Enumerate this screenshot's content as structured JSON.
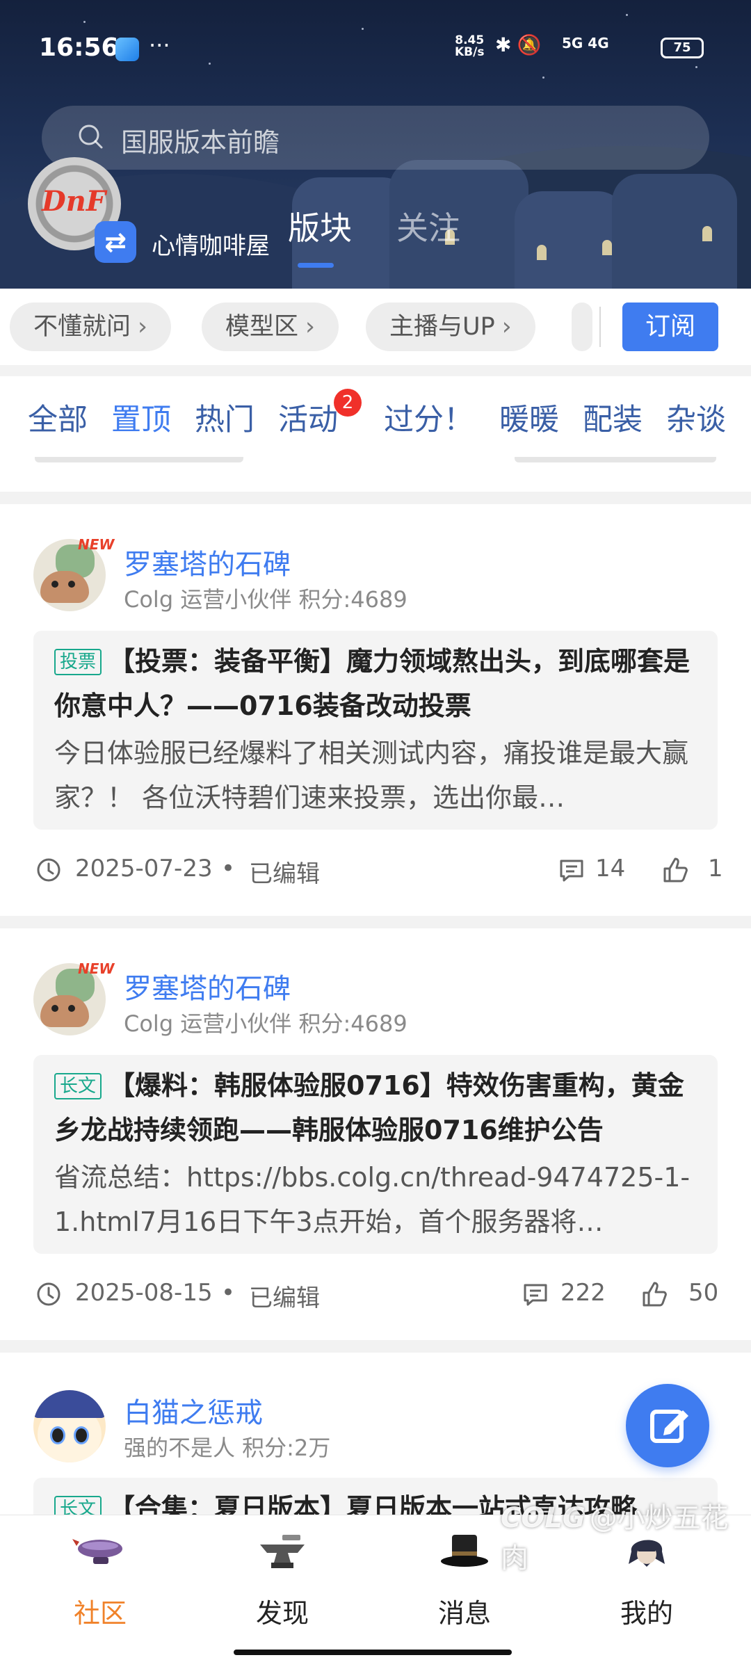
{
  "status_bar": {
    "time": "16:56",
    "dots": "···",
    "net_speed_top": "8.45",
    "net_speed_bottom": "KB/s",
    "signal_labels": "5G 4G",
    "battery": "75"
  },
  "search": {
    "placeholder": "国服版本前瞻"
  },
  "header": {
    "logo_text": "DnF",
    "board_name": "心情咖啡屋",
    "tabs": [
      {
        "label": "版块"
      },
      {
        "label": "关注"
      }
    ]
  },
  "filter_chips": [
    {
      "label": "不懂就问"
    },
    {
      "label": "模型区"
    },
    {
      "label": "主播与UP"
    }
  ],
  "subscribe_label": "订阅",
  "categories": [
    {
      "label": "全部"
    },
    {
      "label": "置顶"
    },
    {
      "label": "热门"
    },
    {
      "label": "活动"
    },
    {
      "label": "过分！"
    },
    {
      "label": "暖暖"
    },
    {
      "label": "配装"
    },
    {
      "label": "杂谈"
    }
  ],
  "category_badge": "2",
  "posts": [
    {
      "new_tag": "NEW",
      "author": "罗塞塔的石碑",
      "author_meta": "Colg 运营小伙伴  积分:4689",
      "tag": "投票",
      "title": "【投票：装备平衡】魔力领域熬出头，到底哪套是你意中人？——0716装备改动投票",
      "excerpt": " 今日体验服已经爆料了相关测试内容，痛投谁是最大赢家？！ 各位沃特碧们速来投票，选出你最…",
      "date": "2025-07-23",
      "dot": "•",
      "edited": "已编辑",
      "comments": "14",
      "likes": "1"
    },
    {
      "new_tag": "NEW",
      "author": "罗塞塔的石碑",
      "author_meta": "Colg 运营小伙伴  积分:4689",
      "tag": "长文",
      "title": "【爆料：韩服体验服0716】特效伤害重构，黄金乡龙战持续领跑——韩服体验服0716维护公告",
      "excerpt": " 省流总结：https://bbs.colg.cn/thread-9474725-1-1.html7月16日下午3点开始，首个服务器将…",
      "date": "2025-08-15",
      "dot": "•",
      "edited": "已编辑",
      "comments": "222",
      "likes": "50"
    },
    {
      "author": "白猫之惩戒",
      "author_meta": "强的不是人  积分:2万",
      "tag": "长文",
      "title": "【合集：夏日版本】夏日版本一站式直达攻略"
    }
  ],
  "bottom_nav": [
    {
      "label": "社区",
      "icon": "airship-icon"
    },
    {
      "label": "发现",
      "icon": "anvil-icon"
    },
    {
      "label": "消息",
      "icon": "top-hat-icon"
    },
    {
      "label": "我的",
      "icon": "character-avatar-icon"
    }
  ],
  "watermark": {
    "logo": "COLG",
    "text": "@小炒五花肉"
  },
  "colors": {
    "accent": "#3f7cf0",
    "active_nav": "#f0822a",
    "tag_green": "#18a88c",
    "badge_red": "#f0302a"
  }
}
